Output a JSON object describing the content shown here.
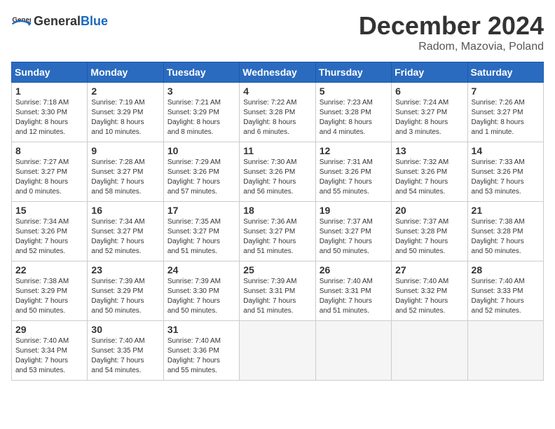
{
  "header": {
    "logo_general": "General",
    "logo_blue": "Blue",
    "title": "December 2024",
    "location": "Radom, Mazovia, Poland"
  },
  "days_of_week": [
    "Sunday",
    "Monday",
    "Tuesday",
    "Wednesday",
    "Thursday",
    "Friday",
    "Saturday"
  ],
  "weeks": [
    [
      {
        "day": "1",
        "lines": [
          "Sunrise: 7:18 AM",
          "Sunset: 3:30 PM",
          "Daylight: 8 hours",
          "and 12 minutes."
        ]
      },
      {
        "day": "2",
        "lines": [
          "Sunrise: 7:19 AM",
          "Sunset: 3:29 PM",
          "Daylight: 8 hours",
          "and 10 minutes."
        ]
      },
      {
        "day": "3",
        "lines": [
          "Sunrise: 7:21 AM",
          "Sunset: 3:29 PM",
          "Daylight: 8 hours",
          "and 8 minutes."
        ]
      },
      {
        "day": "4",
        "lines": [
          "Sunrise: 7:22 AM",
          "Sunset: 3:28 PM",
          "Daylight: 8 hours",
          "and 6 minutes."
        ]
      },
      {
        "day": "5",
        "lines": [
          "Sunrise: 7:23 AM",
          "Sunset: 3:28 PM",
          "Daylight: 8 hours",
          "and 4 minutes."
        ]
      },
      {
        "day": "6",
        "lines": [
          "Sunrise: 7:24 AM",
          "Sunset: 3:27 PM",
          "Daylight: 8 hours",
          "and 3 minutes."
        ]
      },
      {
        "day": "7",
        "lines": [
          "Sunrise: 7:26 AM",
          "Sunset: 3:27 PM",
          "Daylight: 8 hours",
          "and 1 minute."
        ]
      }
    ],
    [
      {
        "day": "8",
        "lines": [
          "Sunrise: 7:27 AM",
          "Sunset: 3:27 PM",
          "Daylight: 8 hours",
          "and 0 minutes."
        ]
      },
      {
        "day": "9",
        "lines": [
          "Sunrise: 7:28 AM",
          "Sunset: 3:27 PM",
          "Daylight: 7 hours",
          "and 58 minutes."
        ]
      },
      {
        "day": "10",
        "lines": [
          "Sunrise: 7:29 AM",
          "Sunset: 3:26 PM",
          "Daylight: 7 hours",
          "and 57 minutes."
        ]
      },
      {
        "day": "11",
        "lines": [
          "Sunrise: 7:30 AM",
          "Sunset: 3:26 PM",
          "Daylight: 7 hours",
          "and 56 minutes."
        ]
      },
      {
        "day": "12",
        "lines": [
          "Sunrise: 7:31 AM",
          "Sunset: 3:26 PM",
          "Daylight: 7 hours",
          "and 55 minutes."
        ]
      },
      {
        "day": "13",
        "lines": [
          "Sunrise: 7:32 AM",
          "Sunset: 3:26 PM",
          "Daylight: 7 hours",
          "and 54 minutes."
        ]
      },
      {
        "day": "14",
        "lines": [
          "Sunrise: 7:33 AM",
          "Sunset: 3:26 PM",
          "Daylight: 7 hours",
          "and 53 minutes."
        ]
      }
    ],
    [
      {
        "day": "15",
        "lines": [
          "Sunrise: 7:34 AM",
          "Sunset: 3:26 PM",
          "Daylight: 7 hours",
          "and 52 minutes."
        ]
      },
      {
        "day": "16",
        "lines": [
          "Sunrise: 7:34 AM",
          "Sunset: 3:27 PM",
          "Daylight: 7 hours",
          "and 52 minutes."
        ]
      },
      {
        "day": "17",
        "lines": [
          "Sunrise: 7:35 AM",
          "Sunset: 3:27 PM",
          "Daylight: 7 hours",
          "and 51 minutes."
        ]
      },
      {
        "day": "18",
        "lines": [
          "Sunrise: 7:36 AM",
          "Sunset: 3:27 PM",
          "Daylight: 7 hours",
          "and 51 minutes."
        ]
      },
      {
        "day": "19",
        "lines": [
          "Sunrise: 7:37 AM",
          "Sunset: 3:27 PM",
          "Daylight: 7 hours",
          "and 50 minutes."
        ]
      },
      {
        "day": "20",
        "lines": [
          "Sunrise: 7:37 AM",
          "Sunset: 3:28 PM",
          "Daylight: 7 hours",
          "and 50 minutes."
        ]
      },
      {
        "day": "21",
        "lines": [
          "Sunrise: 7:38 AM",
          "Sunset: 3:28 PM",
          "Daylight: 7 hours",
          "and 50 minutes."
        ]
      }
    ],
    [
      {
        "day": "22",
        "lines": [
          "Sunrise: 7:38 AM",
          "Sunset: 3:29 PM",
          "Daylight: 7 hours",
          "and 50 minutes."
        ]
      },
      {
        "day": "23",
        "lines": [
          "Sunrise: 7:39 AM",
          "Sunset: 3:29 PM",
          "Daylight: 7 hours",
          "and 50 minutes."
        ]
      },
      {
        "day": "24",
        "lines": [
          "Sunrise: 7:39 AM",
          "Sunset: 3:30 PM",
          "Daylight: 7 hours",
          "and 50 minutes."
        ]
      },
      {
        "day": "25",
        "lines": [
          "Sunrise: 7:39 AM",
          "Sunset: 3:31 PM",
          "Daylight: 7 hours",
          "and 51 minutes."
        ]
      },
      {
        "day": "26",
        "lines": [
          "Sunrise: 7:40 AM",
          "Sunset: 3:31 PM",
          "Daylight: 7 hours",
          "and 51 minutes."
        ]
      },
      {
        "day": "27",
        "lines": [
          "Sunrise: 7:40 AM",
          "Sunset: 3:32 PM",
          "Daylight: 7 hours",
          "and 52 minutes."
        ]
      },
      {
        "day": "28",
        "lines": [
          "Sunrise: 7:40 AM",
          "Sunset: 3:33 PM",
          "Daylight: 7 hours",
          "and 52 minutes."
        ]
      }
    ],
    [
      {
        "day": "29",
        "lines": [
          "Sunrise: 7:40 AM",
          "Sunset: 3:34 PM",
          "Daylight: 7 hours",
          "and 53 minutes."
        ]
      },
      {
        "day": "30",
        "lines": [
          "Sunrise: 7:40 AM",
          "Sunset: 3:35 PM",
          "Daylight: 7 hours",
          "and 54 minutes."
        ]
      },
      {
        "day": "31",
        "lines": [
          "Sunrise: 7:40 AM",
          "Sunset: 3:36 PM",
          "Daylight: 7 hours",
          "and 55 minutes."
        ]
      },
      null,
      null,
      null,
      null
    ]
  ]
}
